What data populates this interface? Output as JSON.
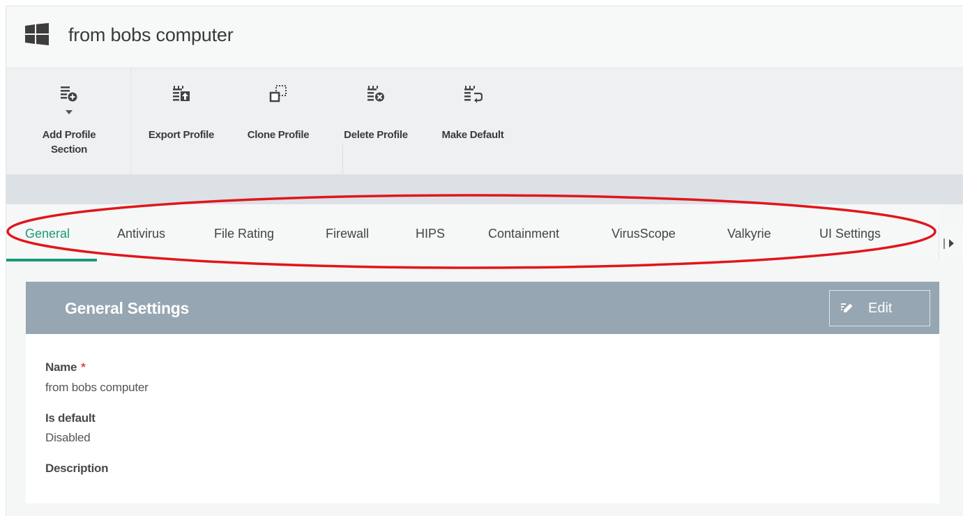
{
  "header": {
    "title": "from bobs computer"
  },
  "toolbar": {
    "add_profile_section": {
      "line1": "Add Profile",
      "line2": "Section"
    },
    "export_profile": "Export Profile",
    "clone_profile": "Clone Profile",
    "delete_profile": "Delete Profile",
    "make_default": "Make Default"
  },
  "tabs": [
    {
      "label": "General",
      "active": true
    },
    {
      "label": "Antivirus"
    },
    {
      "label": "File Rating"
    },
    {
      "label": "Firewall"
    },
    {
      "label": "HIPS"
    },
    {
      "label": "Containment"
    },
    {
      "label": "VirusScope"
    },
    {
      "label": "Valkyrie"
    },
    {
      "label": "UI Settings"
    }
  ],
  "panel": {
    "title": "General Settings",
    "edit_label": "Edit",
    "fields": [
      {
        "label": "Name",
        "required": "*",
        "value": "from bobs computer"
      },
      {
        "label": "Is default",
        "value": "Disabled"
      },
      {
        "label": "Description",
        "value": ""
      }
    ]
  },
  "colors": {
    "accent": "#1a9a79",
    "panel_header": "#96a6b2",
    "annotation_oval": "#e0161b",
    "required": "#e0493a"
  },
  "icons": {
    "window_logo": "windows-icon",
    "add_section": "list-add-icon",
    "export": "export-icon",
    "clone": "clone-icon",
    "delete": "delete-icon",
    "make_default": "make-default-icon",
    "edit": "pencil-icon"
  }
}
